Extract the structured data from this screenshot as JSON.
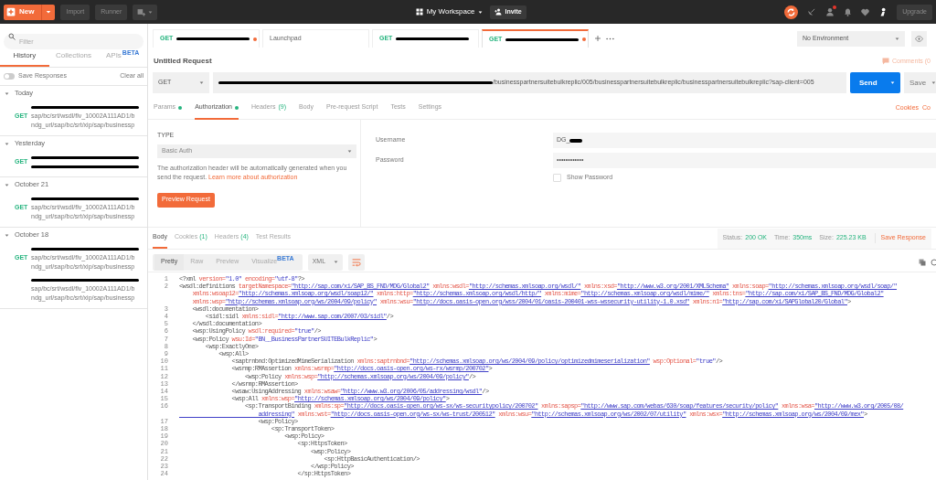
{
  "toolbar": {
    "new_button": "New",
    "import_button": "Import",
    "runner_button": "Runner",
    "workspace": "My Workspace",
    "invite_button": "Invite",
    "upgrade_button": "Upgrade"
  },
  "sidebar": {
    "filter_placeholder": "Filter",
    "tabs": [
      {
        "label": "History",
        "selected": true
      },
      {
        "label": "Collections",
        "selected": false
      },
      {
        "label": "APIs",
        "badge": "BETA",
        "selected": false
      }
    ],
    "save_responses": {
      "label": "Save Responses",
      "on": false
    },
    "clear_all": "Clear all",
    "groups": [
      {
        "label": "Today",
        "expanded": true,
        "items": [
          {
            "method": "GET",
            "lines": [
              {
                "kind": "redacted"
              },
              {
                "kind": "text",
                "text": "sap/bc/srt/wsdl/flv_10002A111AD1/b"
              },
              {
                "kind": "text",
                "text": "ndg_url/sap/bc/srt/xip/sap/businessp"
              }
            ]
          }
        ]
      },
      {
        "label": "Yesterday",
        "expanded": true,
        "items": [
          {
            "method": "GET",
            "lines": [
              {
                "kind": "redacted"
              },
              {
                "kind": "redacted"
              }
            ]
          }
        ]
      },
      {
        "label": "October 21",
        "expanded": true,
        "items": [
          {
            "method": "GET",
            "lines": [
              {
                "kind": "redacted"
              },
              {
                "kind": "text",
                "text": "sap/bc/srt/wsdl/flv_10002A111AD1/b"
              },
              {
                "kind": "text",
                "text": "ndg_url/sap/bc/srt/xip/sap/businessp"
              }
            ]
          }
        ]
      },
      {
        "label": "October 18",
        "expanded": true,
        "items": [
          {
            "method": "GET",
            "lines": [
              {
                "kind": "redacted"
              },
              {
                "kind": "text",
                "text": "sap/bc/srt/wsdl/flv_10002A111AD1/b"
              },
              {
                "kind": "text",
                "text": "ndg_url/sap/bc/srt/xip/sap/businessp"
              }
            ]
          },
          {
            "lines": [
              {
                "kind": "redacted"
              },
              {
                "kind": "text",
                "text": "sap/bc/srt/wsdl/flv_10002A111AD1/b"
              },
              {
                "kind": "text",
                "text": "ndg_url/sap/bc/srt/xip/sap/businessp"
              }
            ]
          }
        ]
      }
    ]
  },
  "open_tabs": [
    {
      "kind": "redacted",
      "method": "GET",
      "unsaved": true,
      "selected": false
    },
    {
      "kind": "named",
      "title": "Launchpad",
      "unsaved": false,
      "selected": false
    },
    {
      "kind": "redacted",
      "method": "GET",
      "unsaved": false,
      "selected": false
    },
    {
      "kind": "redacted",
      "method": "GET",
      "unsaved": true,
      "selected": true
    }
  ],
  "environment": "No Environment",
  "request": {
    "title": "Untitled Request",
    "comments": "Comments (0",
    "method": "GET",
    "url_tail": "/businesspartnersuitebulkreplic/005/businesspartnersuitebulkreplic/businesspartnersuitebulkreplic?sap-client=005",
    "send_button": "Send",
    "save_button": "Save"
  },
  "request_tabs": [
    {
      "label": "Params",
      "dot": true,
      "selected": false
    },
    {
      "label": "Authorization",
      "dot": true,
      "selected": true
    },
    {
      "label": "Headers",
      "count": "(9)",
      "dot": false,
      "selected": false
    },
    {
      "label": "Body",
      "dot": false,
      "selected": false
    },
    {
      "label": "Pre-request Script",
      "dot": false,
      "selected": false
    },
    {
      "label": "Tests",
      "dot": false,
      "selected": false
    },
    {
      "label": "Settings",
      "dot": false,
      "selected": false
    }
  ],
  "cookies_link": "Cookies",
  "code_link": "Co",
  "auth": {
    "type_label": "TYPE",
    "type": "Basic Auth",
    "help": "The authorization header will be automatically generated when you send the request.",
    "help_link": "Learn more about authorization",
    "preview_button": "Preview Request",
    "username_label": "Username",
    "username": "DG_",
    "password_label": "Password",
    "password": "••••••••••••",
    "show_password": {
      "label": "Show Password",
      "checked": false
    }
  },
  "response_tabs": [
    {
      "label": "Body",
      "selected": true
    },
    {
      "label": "Cookies",
      "count": "(1)",
      "selected": false
    },
    {
      "label": "Headers",
      "count": "(4)",
      "selected": false
    },
    {
      "label": "Test Results",
      "selected": false
    }
  ],
  "status": {
    "status_label": "Status:",
    "status": "200 OK",
    "time_label": "Time:",
    "time": "350ms",
    "size_label": "Size:",
    "size": "225.23 KB",
    "save_response": "Save Response"
  },
  "view_modes": [
    {
      "label": "Pretty",
      "selected": true
    },
    {
      "label": "Raw",
      "selected": false
    },
    {
      "label": "Preview",
      "selected": false
    },
    {
      "label": "Visualize",
      "badge": "BETA",
      "selected": false
    }
  ],
  "format": "XML",
  "code": [
    {
      "n": "1",
      "text": "<?xml version=\"1.0\" encoding=\"utf-8\"?>"
    },
    {
      "n": "2",
      "text": "<wsdl:definitions targetNamespace=\"http://sap.com/xi/SAP_BS_FND/MDG/Global2\" xmlns:wsdl=\"http://schemas.xmlsoap.org/wsdl/\" xmlns:xsd=\"http://www.w3.org/2001/XMLSchema\" xmlns:soap=\"http://schemas.xmlsoap.org/wsdl/soap/\""
    },
    {
      "text": "    xmlns:wsoap12=\"http://schemas.xmlsoap.org/wsdl/soap12/\" xmlns:http=\"http://schemas.xmlsoap.org/wsdl/http/\" xmlns:mime=\"http://schemas.xmlsoap.org/wsdl/mime/\" xmlns:tns=\"http://sap.com/xi/SAP_BS_FND/MDG/Global2\""
    },
    {
      "text": "    xmlns:wsp=\"http://schemas.xmlsoap.org/ws/2004/09/policy\" xmlns:wsu=\"http://docs.oasis-open.org/wss/2004/01/oasis-200401-wss-wssecurity-utility-1.0.xsd\" xmlns:n1=\"http://sap.com/xi/SAPGlobal20/Global\">"
    },
    {
      "n": "3",
      "text": "    <wsdl:documentation>"
    },
    {
      "n": "4",
      "text": "        <sidl:sidl xmlns:sidl=\"http://www.sap.com/2007/03/sidl\"/>"
    },
    {
      "n": "5",
      "text": "    </wsdl:documentation>"
    },
    {
      "n": "6",
      "text": "    <wsp:UsingPolicy wsdl:required=\"true\"/>"
    },
    {
      "n": "7",
      "text": "    <wsp:Policy wsu:Id=\"BN__BusinessPartnerSUITEBulkReplic\">"
    },
    {
      "n": "8",
      "text": "        <wsp:ExactlyOne>"
    },
    {
      "n": "9",
      "text": "            <wsp:All>"
    },
    {
      "n": "10",
      "text": "                <saptrnbnd:OptimizedMimeSerialization xmlns:saptrnbnd=\"http://schemas.xmlsoap.org/ws/2004/09/policy/optimizedmimeserialization\" wsp:Optional=\"true\"/>"
    },
    {
      "n": "11",
      "text": "                <wsrmp:RMAssertion xmlns:wsrmp=\"http://docs.oasis-open.org/ws-rx/wsrmp/200702\">"
    },
    {
      "n": "12",
      "text": "                    <wsp:Policy xmlns:wsp=\"http://schemas.xmlsoap.org/ws/2004/09/policy\"/>"
    },
    {
      "n": "13",
      "text": "                </wsrmp:RMAssertion>"
    },
    {
      "n": "14",
      "text": "                <wsaw:UsingAddressing xmlns:wsaw=\"http://www.w3.org/2006/05/addressing/wsdl\"/>"
    },
    {
      "n": "15",
      "text": "                <wsp:All xmlns:wsp=\"http://schemas.xmlsoap.org/ws/2004/09/policy\">"
    },
    {
      "n": "16",
      "text": "                    <sp:TransportBinding xmlns:sp=\"http://docs.oasis-open.org/ws-sx/ws-securitypolicy/200702\" xmlns:sapsp=\"http://www.sap.com/webas/630/soap/features/security/policy\" xmlns:wsa=\"http://www.w3.org/2005/08/"
    },
    {
      "text": "                        addressing\" xmlns:wst=\"http://docs.oasis-open.org/ws-sx/ws-trust/200512\" xmlns:wsu=\"http://schemas.xmlsoap.org/ws/2002/07/utility\" xmlns:wsx=\"http://schemas.xmlsoap.org/ws/2004/09/mex\">"
    },
    {
      "n": "17",
      "text": "                        <wsp:Policy>"
    },
    {
      "n": "18",
      "text": "                            <sp:TransportToken>"
    },
    {
      "n": "19",
      "text": "                                <wsp:Policy>"
    },
    {
      "n": "20",
      "text": "                                    <sp:HttpsToken>"
    },
    {
      "n": "21",
      "text": "                                        <wsp:Policy>"
    },
    {
      "n": "22",
      "text": "                                            <sp:HttpBasicAuthentication/>"
    },
    {
      "n": "23",
      "text": "                                        </wsp:Policy>"
    },
    {
      "n": "24",
      "text": "                                    </sp:HttpsToken>"
    }
  ]
}
